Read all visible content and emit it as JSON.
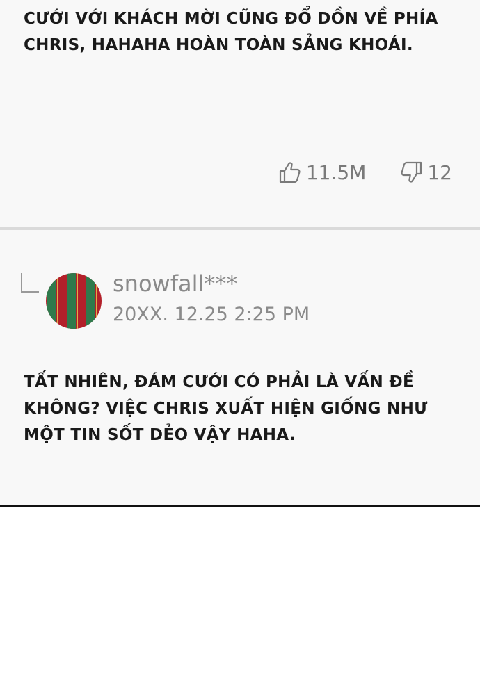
{
  "comment": {
    "body_lines": [
      "cưới với khách mời cũng đổ dồn về phía",
      "chris, hahaha hoàn toàn sảng khoái."
    ],
    "likes": "11.5M",
    "dislikes": "12"
  },
  "reply": {
    "username": "snowfall***",
    "timestamp": "20XX. 12.25  2:25 PM",
    "body_lines": [
      "tất nhiên, đám cưới có phải là vấn đề",
      "không? việc chris xuất hiện giống như",
      "một tin sốt dẻo vậy haha."
    ],
    "avatar_colors": [
      "#2f7a4c",
      "#b3202a",
      "#d8b24a"
    ]
  },
  "colors": {
    "card_background": "#f8f8f8",
    "separator": "#dadada",
    "meta_text": "#8a8a8a",
    "body_text": "#1a1a1a",
    "bottom_rule": "#111111"
  }
}
